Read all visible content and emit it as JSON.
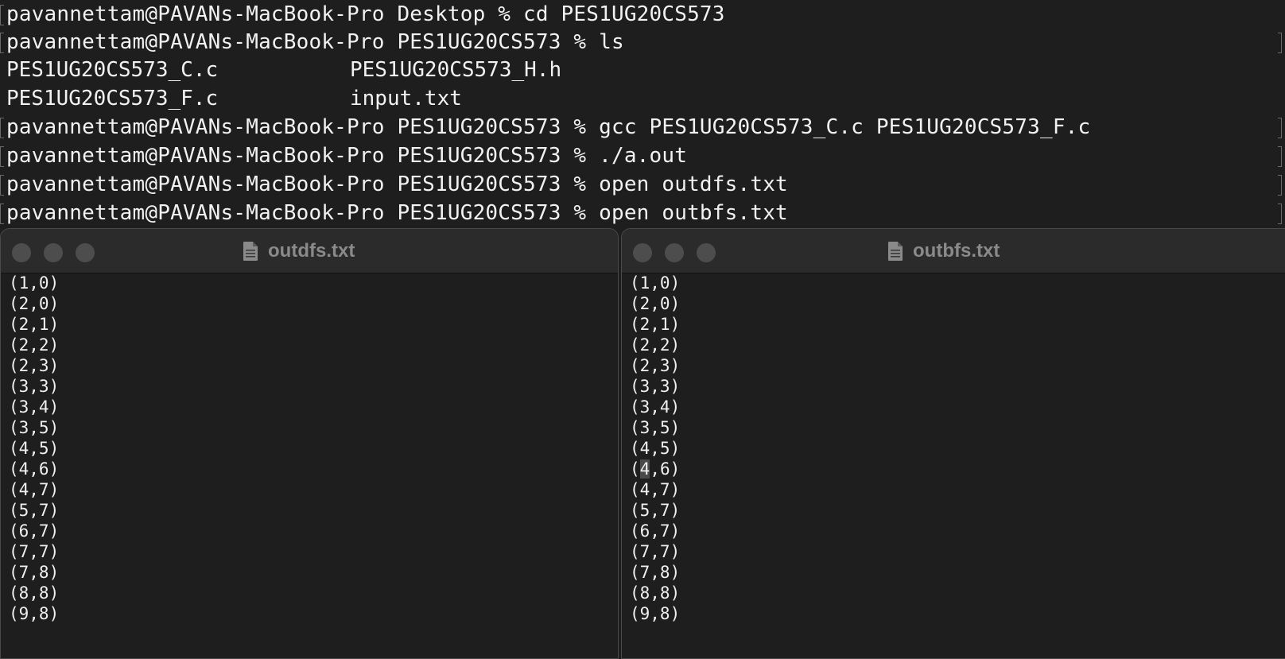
{
  "terminal": {
    "lines": [
      "pavannettam@PAVANs-MacBook-Pro Desktop % cd PES1UG20CS573",
      "pavannettam@PAVANs-MacBook-Pro PES1UG20CS573 % ls",
      "pavannettam@PAVANs-MacBook-Pro PES1UG20CS573 % gcc PES1UG20CS573_C.c PES1UG20CS573_F.c",
      "pavannettam@PAVANs-MacBook-Pro PES1UG20CS573 % ./a.out",
      "pavannettam@PAVANs-MacBook-Pro PES1UG20CS573 % open outdfs.txt",
      "pavannettam@PAVANs-MacBook-Pro PES1UG20CS573 % open outbfs.txt"
    ],
    "ls_output": [
      [
        "PES1UG20CS573_C.c",
        "PES1UG20CS573_H.h"
      ],
      [
        "PES1UG20CS573_F.c",
        "input.txt"
      ]
    ]
  },
  "windows": [
    {
      "title": "outdfs.txt",
      "lines": [
        "(1,0)",
        "(2,0)",
        "(2,1)",
        "(2,2)",
        "(2,3)",
        "(3,3)",
        "(3,4)",
        "(3,5)",
        "(4,5)",
        "(4,6)",
        "(4,7)",
        "(5,7)",
        "(6,7)",
        "(7,7)",
        "(7,8)",
        "(8,8)",
        "(9,8)"
      ]
    },
    {
      "title": "outbfs.txt",
      "lines": [
        "(1,0)",
        "(2,0)",
        "(2,1)",
        "(2,2)",
        "(2,3)",
        "(3,3)",
        "(3,4)",
        "(3,5)",
        "(4,5)",
        "(4,6)",
        "(4,7)",
        "(5,7)",
        "(6,7)",
        "(7,7)",
        "(7,8)",
        "(8,8)",
        "(9,8)"
      ],
      "highlight_line_index": 9,
      "highlight_char": "4",
      "highlight_prefix": "(",
      "highlight_suffix": ",6)"
    }
  ],
  "icons": {
    "document": "document-icon",
    "traffic_light": "window-control-button"
  },
  "colors": {
    "background": "#1e1e1e",
    "text": "#f2f2f2",
    "title_text": "#8a8a8a",
    "traffic_light": "#4d4d4d"
  }
}
